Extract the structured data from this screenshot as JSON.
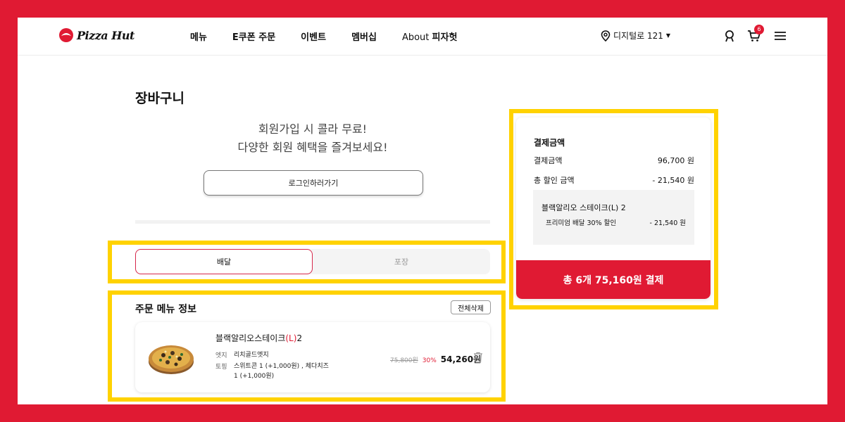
{
  "brand": {
    "logo_text": "Pizza Hut"
  },
  "nav": [
    "메뉴",
    "E쿠폰 주문",
    "이벤트",
    "멤버십"
  ],
  "nav_about": {
    "prefix": "About ",
    "bold": "피자헛"
  },
  "location": "디지털로 121",
  "cart_count": "6",
  "page_title": "장바구니",
  "promo": {
    "line1": "회원가입 시 콜라 무료!",
    "line2": "다양한 회원 혜택을 즐겨보세요!"
  },
  "login_button": "로그인하러가기",
  "tabs": {
    "delivery": "배달",
    "pickup": "포장"
  },
  "order": {
    "title": "주문 메뉴 정보",
    "delete_all": "전체삭제",
    "item": {
      "name_prefix": "블랙알리오스테이크",
      "size": "(L)",
      "qty": "2",
      "edge_label": "엣지",
      "edge_value": "리치골드엣지",
      "topping_label": "토핑",
      "topping_value": "스위트콘 1 (+1,000원) , 체다치즈 1 (+1,000원)",
      "original_price": "75,800원",
      "discount": "30%",
      "final_price": "54,260원"
    }
  },
  "summary": {
    "title": "결제금액",
    "payment_label": "결제금액",
    "payment_value": "96,700 원",
    "discount_label": "총 할인 금액",
    "discount_value": "- 21,540 원",
    "detail_item": "블랙알리오 스테이크(L) 2",
    "detail_label": "프리미엄 배달 30% 할인",
    "detail_value": "- 21,540 원",
    "pay_button": "총 6개 75,160원 결제"
  },
  "colors": {
    "brand_red": "#e01a33",
    "highlight": "#ffd200"
  }
}
